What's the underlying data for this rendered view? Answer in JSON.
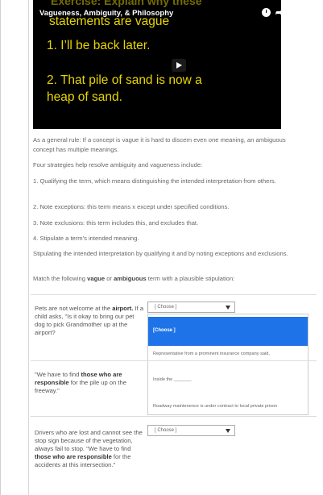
{
  "video": {
    "background_title": "Exercise: Explain why these",
    "title": "Vagueness, Ambiguity, & Philosophy",
    "subline": "statements are vague",
    "statement1": "1.  I’ll be back later.",
    "statement2": "2. That pile of sand is now a heap of sand.",
    "icons": [
      "clock-icon",
      "share-icon",
      "play-icon"
    ],
    "text_color": "#e8d600"
  },
  "content": {
    "p1": "As a general rule: If a concept is vague it is hard to discern even one meaning, an ambiguous concept has multiple meanings.",
    "p2": "Four strategies help resolve ambiguity and vagueness include:",
    "s1": "1. Qualifying the term, which means distinguishing the intended interpretation from others.",
    "s2": "2. Note exceptions: this term means x except under specified conditions.",
    "s3": "3. Note exclusions: this term includes this, and excludes that.",
    "s4": "4. Stipulate a term's intended meaning.",
    "p3": "Stipulating the intended interpretation by qualifying it and by noting exceptions and exclusions.",
    "instr_before": "Match the following ",
    "instr_vague": "vague",
    "instr_or": " or ",
    "instr_ambiguous": "ambiguous",
    "instr_after": " term with a plausible stipulation:"
  },
  "questions": [
    {
      "text_before": "Pets are not welcome at the ",
      "bold": "airport.",
      "text_after": " If a child asks, \"Is it okay to bring our pet dog to pick Grandmother up at the airport?",
      "select_value": "[ Choose ]"
    },
    {
      "text_before": "\"We have to find ",
      "bold": "those who are responsible",
      "text_after": " for the pile up on the freeway.\"",
      "select_value": "[ Choose ]"
    },
    {
      "text_before": "Drivers who are lost and cannot see the stop sign because of the vegetation, always fail to stop. \"We have to find ",
      "bold": "those who are responsible",
      "text_after": " for the accidents at this intersection.\"",
      "select_value": "[ Choose ]"
    }
  ],
  "dropdown": {
    "selected": "[Choose ]",
    "options": [
      "Representative from a prominent insurance company said,",
      "Inside the _______",
      "Roadway maintenence is under contract to local private prison"
    ],
    "highlight_color": "#1e73e8"
  }
}
